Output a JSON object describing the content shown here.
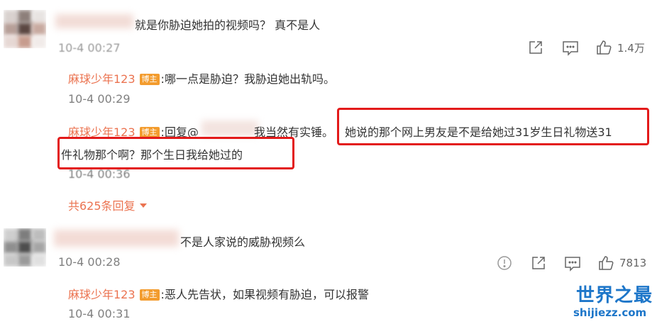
{
  "comment1": {
    "text": "就是你胁迫她拍的视频吗？ 真不是人",
    "time": "10-4 00:27",
    "like_count": "1.4万"
  },
  "reply1": {
    "username": "麻球少年123",
    "badge": "博主",
    "text": ":哪一点是胁迫？我胁迫她出轨吗。",
    "time": "10-4 00:29"
  },
  "reply2": {
    "username": "麻球少年123",
    "badge": "博主",
    "prefix": ":回复@",
    "text_a": "我当然有实锤。",
    "text_b": "她说的那个网上男友是不是给她过31岁生日礼物送31",
    "text_c": "件礼物那个啊？那个生日我给她过的",
    "time": "10-4 00:36"
  },
  "more_replies": {
    "label": "共625条回复"
  },
  "comment2": {
    "text": "不是人家说的威胁视频么",
    "time": "10-4 00:28",
    "like_count": "7813"
  },
  "reply3": {
    "username": "麻球少年123",
    "badge": "博主",
    "text": ":恶人先告状，如果视频有胁迫，可以报警",
    "time": "10-4 00:31"
  },
  "watermark": {
    "title": "世界之最",
    "url": "shijiezz.com"
  },
  "colors": {
    "username": "#eb7350",
    "highlight_border": "#e31a1a",
    "badge": "#f39c2e",
    "watermark": "#1d76c9"
  },
  "icons": [
    "share-icon",
    "comment-icon",
    "like-icon",
    "report-icon",
    "caret-down-icon"
  ]
}
